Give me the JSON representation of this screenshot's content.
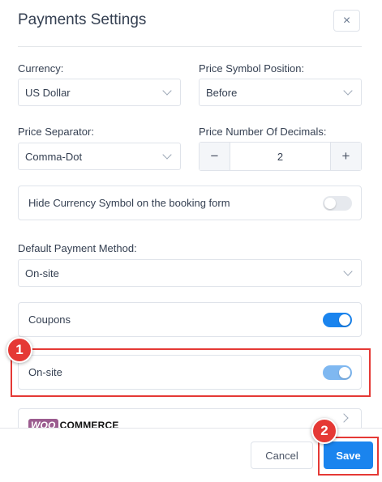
{
  "dialog": {
    "title": "Payments Settings",
    "close_glyph": "×"
  },
  "currency": {
    "label": "Currency:",
    "value": "US Dollar"
  },
  "symbol_position": {
    "label": "Price Symbol Position:",
    "value": "Before"
  },
  "separator": {
    "label": "Price Separator:",
    "value": "Comma-Dot"
  },
  "decimals": {
    "label": "Price Number Of Decimals:",
    "value": "2",
    "minus": "−",
    "plus": "+"
  },
  "hide_symbol": {
    "label": "Hide Currency Symbol on the booking form",
    "enabled": false
  },
  "default_method": {
    "label": "Default Payment Method:",
    "value": "On-site"
  },
  "coupons": {
    "label": "Coupons",
    "enabled": true
  },
  "onsite": {
    "label": "On-site",
    "enabled": true
  },
  "woocommerce": {
    "logo_badge": "WOO",
    "logo_text": "COMMERCE"
  },
  "footer": {
    "cancel_label": "Cancel",
    "save_label": "Save"
  },
  "annotations": {
    "marker_1": "1",
    "marker_2": "2",
    "highlight_color": "#e53935"
  },
  "colors": {
    "accent": "#1a84ee",
    "toggle_off": "#e6e9ee"
  }
}
